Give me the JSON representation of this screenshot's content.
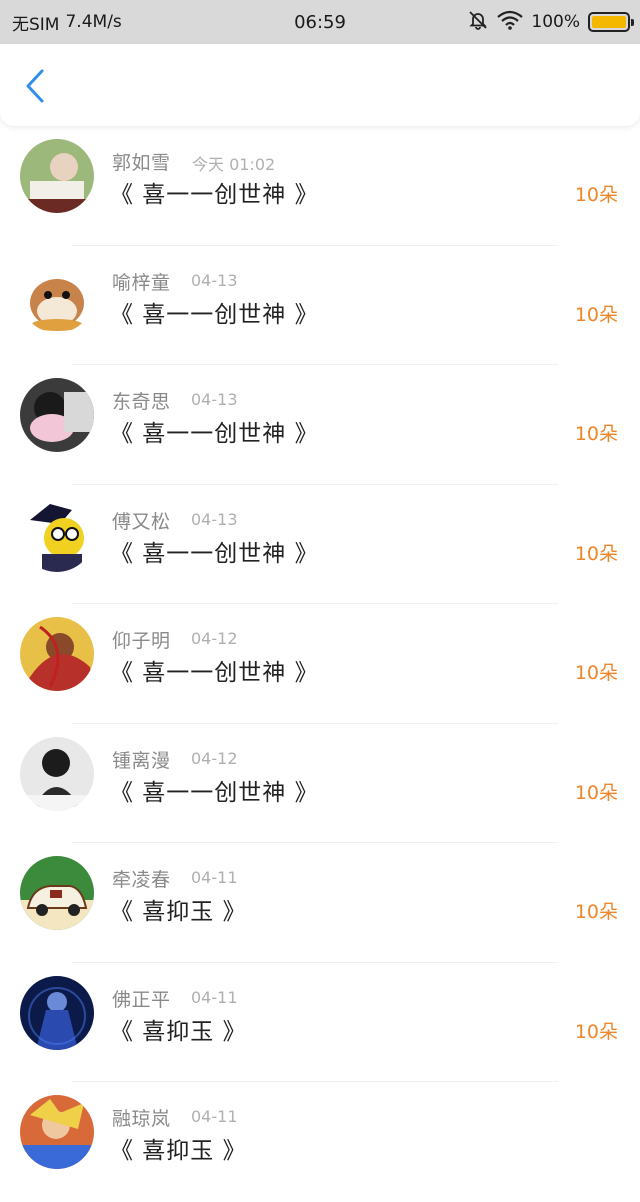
{
  "status_bar": {
    "carrier": "无SIM",
    "speed": "7.4M/s",
    "time": "06:59",
    "battery": "100%",
    "battery_color": "#f5b800"
  },
  "navbar": {
    "back_icon": "chevron-left-icon",
    "accent": "#2f8fe8"
  },
  "accent_orange": "#f0862a",
  "items": [
    {
      "name": "郭如雪",
      "date": "今天 01:02",
      "title": "《 喜一一创世神 》",
      "flowers": "10朵"
    },
    {
      "name": "喻梓童",
      "date": "04-13",
      "title": "《 喜一一创世神 》",
      "flowers": "10朵"
    },
    {
      "name": "东奇思",
      "date": "04-13",
      "title": "《 喜一一创世神 》",
      "flowers": "10朵"
    },
    {
      "name": "傅又松",
      "date": "04-13",
      "title": "《 喜一一创世神 》",
      "flowers": "10朵"
    },
    {
      "name": "仰子明",
      "date": "04-12",
      "title": "《 喜一一创世神 》",
      "flowers": "10朵"
    },
    {
      "name": "锺离漫",
      "date": "04-12",
      "title": "《 喜一一创世神 》",
      "flowers": "10朵"
    },
    {
      "name": "牵凌春",
      "date": "04-11",
      "title": "《 喜抑玉 》",
      "flowers": "10朵"
    },
    {
      "name": "佛正平",
      "date": "04-11",
      "title": "《 喜抑玉 》",
      "flowers": "10朵"
    },
    {
      "name": "融琼岚",
      "date": "04-11",
      "title": "《 喜抑玉 》",
      "flowers": ""
    }
  ]
}
